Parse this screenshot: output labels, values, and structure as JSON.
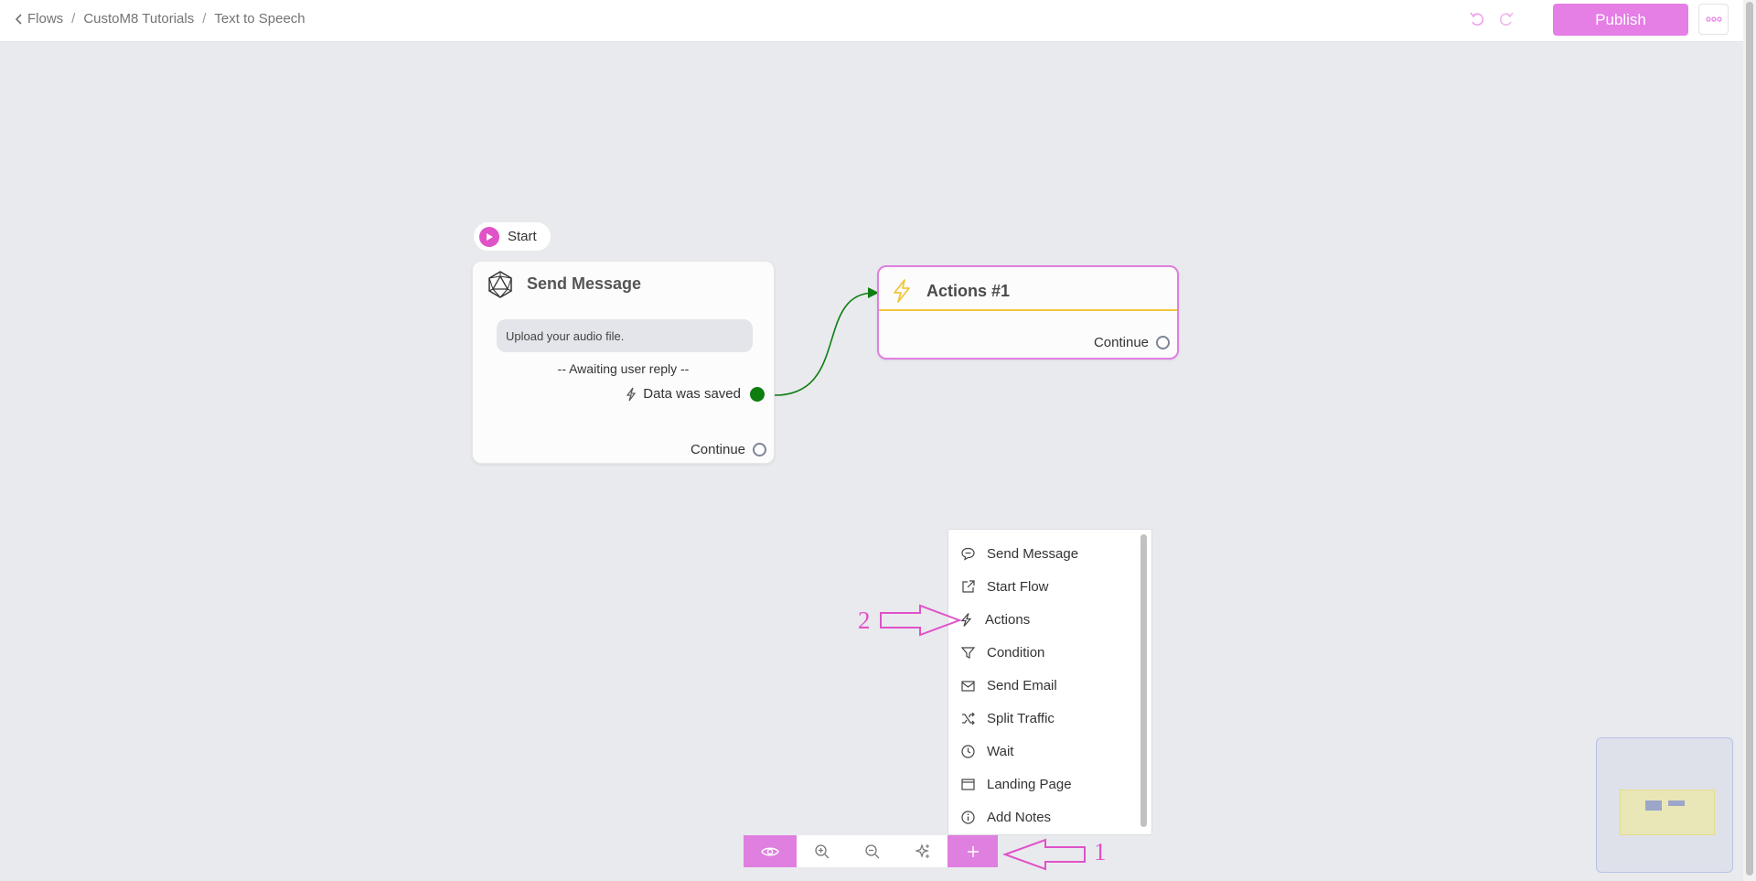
{
  "header": {
    "breadcrumb": [
      "Flows",
      "CustoM8 Tutorials",
      "Text to Speech"
    ],
    "publish_label": "Publish"
  },
  "colors": {
    "accent": "#e57ee5",
    "canvas": "#e9eaee",
    "connected": "#0e7d10",
    "actions_bar": "#f0c63b"
  },
  "canvas": {
    "start_label": "Start",
    "send_message_node": {
      "title": "Send Message",
      "message": "Upload your audio file.",
      "awaiting": "-- Awaiting user reply --",
      "event_label": "Data was saved",
      "continue_label": "Continue"
    },
    "actions_node": {
      "title": "Actions #1",
      "continue_label": "Continue"
    }
  },
  "menu": {
    "items": [
      {
        "label": "Send Message",
        "icon": "chat-bubble-icon"
      },
      {
        "label": "Start Flow",
        "icon": "external-link-icon"
      },
      {
        "label": "Actions",
        "icon": "bolt-icon"
      },
      {
        "label": "Condition",
        "icon": "filter-icon"
      },
      {
        "label": "Send Email",
        "icon": "envelope-icon"
      },
      {
        "label": "Split Traffic",
        "icon": "shuffle-icon"
      },
      {
        "label": "Wait",
        "icon": "clock-icon"
      },
      {
        "label": "Landing Page",
        "icon": "browser-window-icon"
      },
      {
        "label": "Add Notes",
        "icon": "info-icon"
      }
    ]
  },
  "toolbar": {
    "icons": [
      "eye-icon",
      "zoom-in-icon",
      "zoom-out-icon",
      "magic-wand-icon",
      "plus-icon"
    ]
  },
  "annotations": {
    "one": "1",
    "two": "2"
  }
}
